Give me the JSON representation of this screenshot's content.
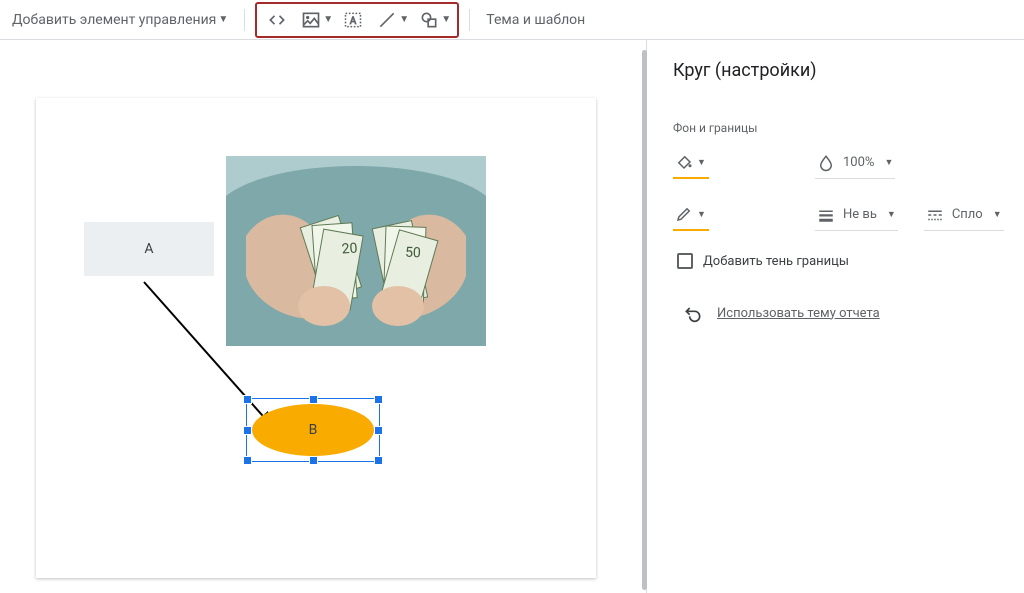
{
  "toolbar": {
    "add_control": "Добавить элемент управления",
    "theme_template": "Тема и шаблон"
  },
  "panel": {
    "title": "Круг (настройки)",
    "section_bg_border": "Фон и границы",
    "opacity_value": "100%",
    "line_weight_value": "Не вь",
    "line_style_value": "Спло",
    "checkbox_shadow": "Добавить тень границы",
    "reset_link": "Использовать тему отчета"
  },
  "canvas": {
    "rect_label": "A",
    "ellipse_label": "B"
  },
  "icons": {
    "embed": "embed-code-icon",
    "image": "image-icon",
    "textbox": "textbox-icon",
    "line": "line-icon",
    "shape": "shape-icon"
  }
}
